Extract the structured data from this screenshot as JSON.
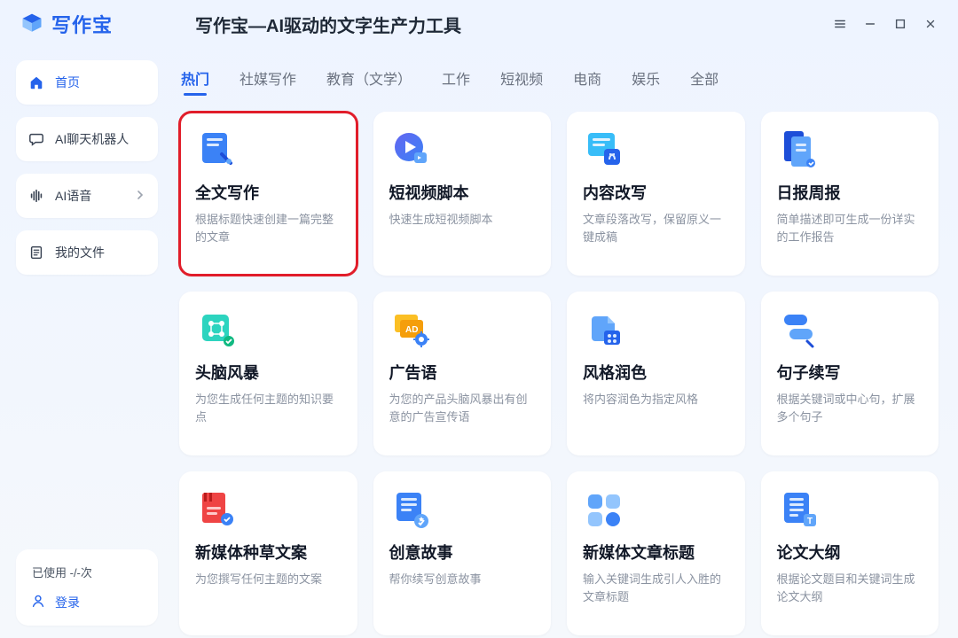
{
  "app": {
    "name": "写作宝",
    "title": "写作宝—AI驱动的文字生产力工具"
  },
  "sidebar": {
    "items": [
      {
        "label": "首页"
      },
      {
        "label": "AI聊天机器人"
      },
      {
        "label": "AI语音"
      },
      {
        "label": "我的文件"
      }
    ],
    "usage": "已使用 -/-次",
    "login": "登录"
  },
  "tabs": [
    {
      "label": "热门",
      "active": true
    },
    {
      "label": "社媒写作"
    },
    {
      "label": "教育（文学）"
    },
    {
      "label": "工作"
    },
    {
      "label": "短视频"
    },
    {
      "label": "电商"
    },
    {
      "label": "娱乐"
    },
    {
      "label": "全部"
    }
  ],
  "cards": [
    {
      "title": "全文写作",
      "desc": "根据标题快速创建一篇完整的文章",
      "highlight": true
    },
    {
      "title": "短视频脚本",
      "desc": "快速生成短视频脚本"
    },
    {
      "title": "内容改写",
      "desc": "文章段落改写，保留原义一键成稿"
    },
    {
      "title": "日报周报",
      "desc": "简单描述即可生成一份详实的工作报告"
    },
    {
      "title": "头脑风暴",
      "desc": "为您生成任何主题的知识要点"
    },
    {
      "title": "广告语",
      "desc": "为您的产品头脑风暴出有创意的广告宣传语"
    },
    {
      "title": "风格润色",
      "desc": "将内容润色为指定风格"
    },
    {
      "title": "句子续写",
      "desc": "根据关键词或中心句，扩展多个句子"
    },
    {
      "title": "新媒体种草文案",
      "desc": "为您撰写任何主题的文案"
    },
    {
      "title": "创意故事",
      "desc": "帮你续写创意故事"
    },
    {
      "title": "新媒体文章标题",
      "desc": "输入关键词生成引人入胜的文章标题"
    },
    {
      "title": "论文大纲",
      "desc": "根据论文题目和关键词生成论文大纲"
    }
  ]
}
